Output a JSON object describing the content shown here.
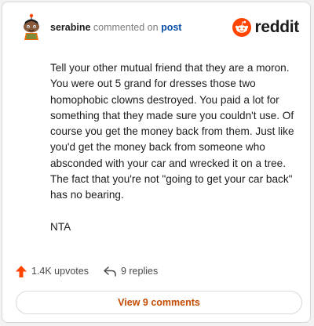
{
  "comment": {
    "username": "serabine",
    "action_text": "commented on",
    "target_link": "post",
    "paragraphs": [
      "Tell your other mutual friend that they are a moron. You were out 5 grand for dresses those two homophobic clowns destroyed. You paid a lot for something that they made sure you couldn't use. Of course you get the money back from them. Just like you'd get the money back from someone who absconded with your car and wrecked it on a tree. The fact that you're not \"going to get your car back\" has no bearing.",
      "NTA"
    ],
    "upvotes": "1.4K upvotes",
    "replies": "9 replies",
    "view_comments_label": "View 9 comments"
  },
  "brand": {
    "name": "reddit",
    "icon": "reddit-snoo-icon"
  },
  "colors": {
    "accent": "#ff4500",
    "link": "#0a4ea8",
    "button_text": "#c44b00"
  }
}
